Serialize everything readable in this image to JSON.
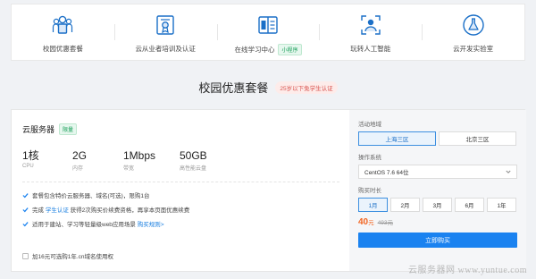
{
  "nav": {
    "items": [
      {
        "label": "校园优惠套餐",
        "icon": "people-icon"
      },
      {
        "label": "云从业者培训及认证",
        "icon": "certificate-icon"
      },
      {
        "label": "在线学习中心",
        "icon": "book-icon",
        "badge": "小程序"
      },
      {
        "label": "玩转人工智能",
        "icon": "ai-scan-icon"
      },
      {
        "label": "云开发实验室",
        "icon": "flask-icon"
      }
    ]
  },
  "section": {
    "title": "校园优惠套餐",
    "tag": "25岁以下免学生认证"
  },
  "product": {
    "name": "云服务器",
    "badge": "限量",
    "specs": [
      {
        "value": "1核",
        "label": "CPU"
      },
      {
        "value": "2G",
        "label": "内存"
      },
      {
        "value": "1Mbps",
        "label": "带宽"
      },
      {
        "value": "50GB",
        "label": "高性能云盘"
      }
    ],
    "features": [
      {
        "text": "套餐包含特价云服务器、域名(可选)，限购1台"
      },
      {
        "pre": "完成 ",
        "link": "学生认证",
        "post": " 获得2次购买价续费资格，再享本页面优惠续费"
      },
      {
        "pre": "适用于建站、学习等轻量级web应用场景 ",
        "link": "购买规则>",
        "post": ""
      }
    ],
    "offer": "加16元可选购1年.cn域名使用权"
  },
  "order": {
    "region_label": "活动地域",
    "regions": [
      "上海三区",
      "北京三区"
    ],
    "os_label": "操作系统",
    "os_value": "CentOS 7.6 64位",
    "duration_label": "购买时长",
    "durations": [
      "1月",
      "2月",
      "3月",
      "6月",
      "1年"
    ],
    "price": "40",
    "price_unit": "元",
    "price_old": "493元",
    "buy_label": "立即购买"
  },
  "watermark": "云服务器网 www.yuntue.com",
  "colors": {
    "primary": "#1a82f0",
    "price": "#f26522",
    "badge_green": "#1aa05a"
  }
}
